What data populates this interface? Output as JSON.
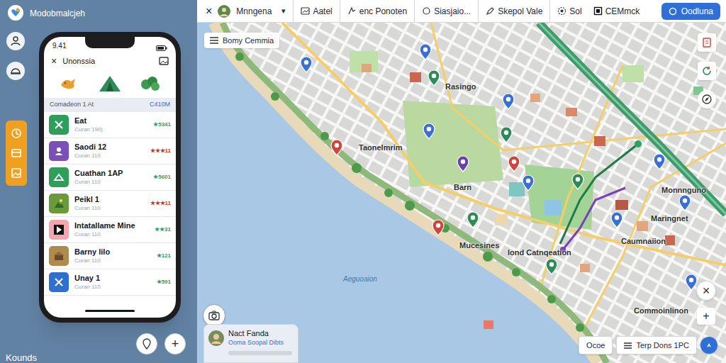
{
  "app": {
    "title": "Modobmalcjeh",
    "footer": "Kounds"
  },
  "phone": {
    "time": "9.41",
    "close": "×",
    "title": "Unonssia",
    "section": {
      "label": "Comadeon 1 At",
      "value": "C410M"
    },
    "items": [
      {
        "title": "Eat",
        "subtitle": "Curan 190)",
        "rating": "★5341",
        "color": "#2e9e5b",
        "rating_color": "#2f9e6a"
      },
      {
        "title": "Saodi 12",
        "subtitle": "Curan 110",
        "rating": "★★★11",
        "color": "#7b4fb8",
        "rating_color": "#c0392b"
      },
      {
        "title": "Cuathan 1AP",
        "subtitle": "Curan 110",
        "rating": "★5601",
        "color": "#2e9e5b",
        "rating_color": "#2f9e6a"
      },
      {
        "title": "Peikl 1",
        "subtitle": "Curan 110",
        "rating": "★★★11",
        "color": "#6a9a3a",
        "rating_color": "#c0392b"
      },
      {
        "title": "Intatallame Mine",
        "subtitle": "Curan 110",
        "rating": "★★31",
        "color": "#f4a6b0",
        "rating_color": "#2f9e6a"
      },
      {
        "title": "Barny lilo",
        "subtitle": "Curan 110",
        "rating": "★121",
        "color": "#b08a4a",
        "rating_color": "#2f9e6a"
      },
      {
        "title": "Unay 1",
        "subtitle": "Curan 110",
        "rating": "★591",
        "color": "#2f6fd0",
        "rating_color": "#2f9e6a"
      }
    ]
  },
  "phone_actions": {
    "add": "+"
  },
  "toolbar": {
    "close": "×",
    "profile": "Mnngena",
    "chevron": "▾",
    "tabs": [
      {
        "label": "Aatel",
        "selected": false
      },
      {
        "label": "enc Ponoten",
        "selected": false
      },
      {
        "label": "Siasjaio...",
        "selected": false
      },
      {
        "label": "Skepol Vale",
        "selected": false
      },
      {
        "label": "Sol",
        "selected": false
      },
      {
        "label": "CEMmck",
        "selected": false
      }
    ],
    "action": "Oodluna"
  },
  "map": {
    "chip": "Bomy Cemmia",
    "water_label": "Aeguoaion",
    "labels": [
      "Rasingo",
      "Taonelmrim",
      "Barn",
      "Mucesines",
      "lond Catnqeation",
      "Caumnaiion",
      "Monnnguno",
      "Maringnet",
      "Commoinlinon"
    ],
    "pins": [
      {
        "color": "#3a6fd6"
      },
      {
        "color": "#3a6fd6"
      },
      {
        "color": "#2e8b57"
      },
      {
        "color": "#3a6fd6"
      },
      {
        "color": "#3a6fd6"
      },
      {
        "color": "#2e8b57"
      },
      {
        "color": "#6a3fb0"
      },
      {
        "color": "#d0443a"
      },
      {
        "color": "#d0443a"
      },
      {
        "color": "#2e8b57"
      },
      {
        "color": "#3a6fd6"
      },
      {
        "color": "#2e8b57"
      },
      {
        "color": "#d0443a"
      },
      {
        "color": "#2e8b57"
      },
      {
        "color": "#3a6fd6"
      },
      {
        "color": "#3a6fd6"
      },
      {
        "color": "#3a6fd6"
      },
      {
        "color": "#3a6fd6"
      }
    ]
  },
  "card": {
    "title": "Nact Fanda",
    "subtitle": "Ooma Soopal Dibts"
  },
  "controls": {
    "close": "×",
    "zoom_in": "+"
  },
  "bottom_bar": {
    "buttons": [
      "Ocoe",
      "Terp Dons 1PC"
    ]
  }
}
